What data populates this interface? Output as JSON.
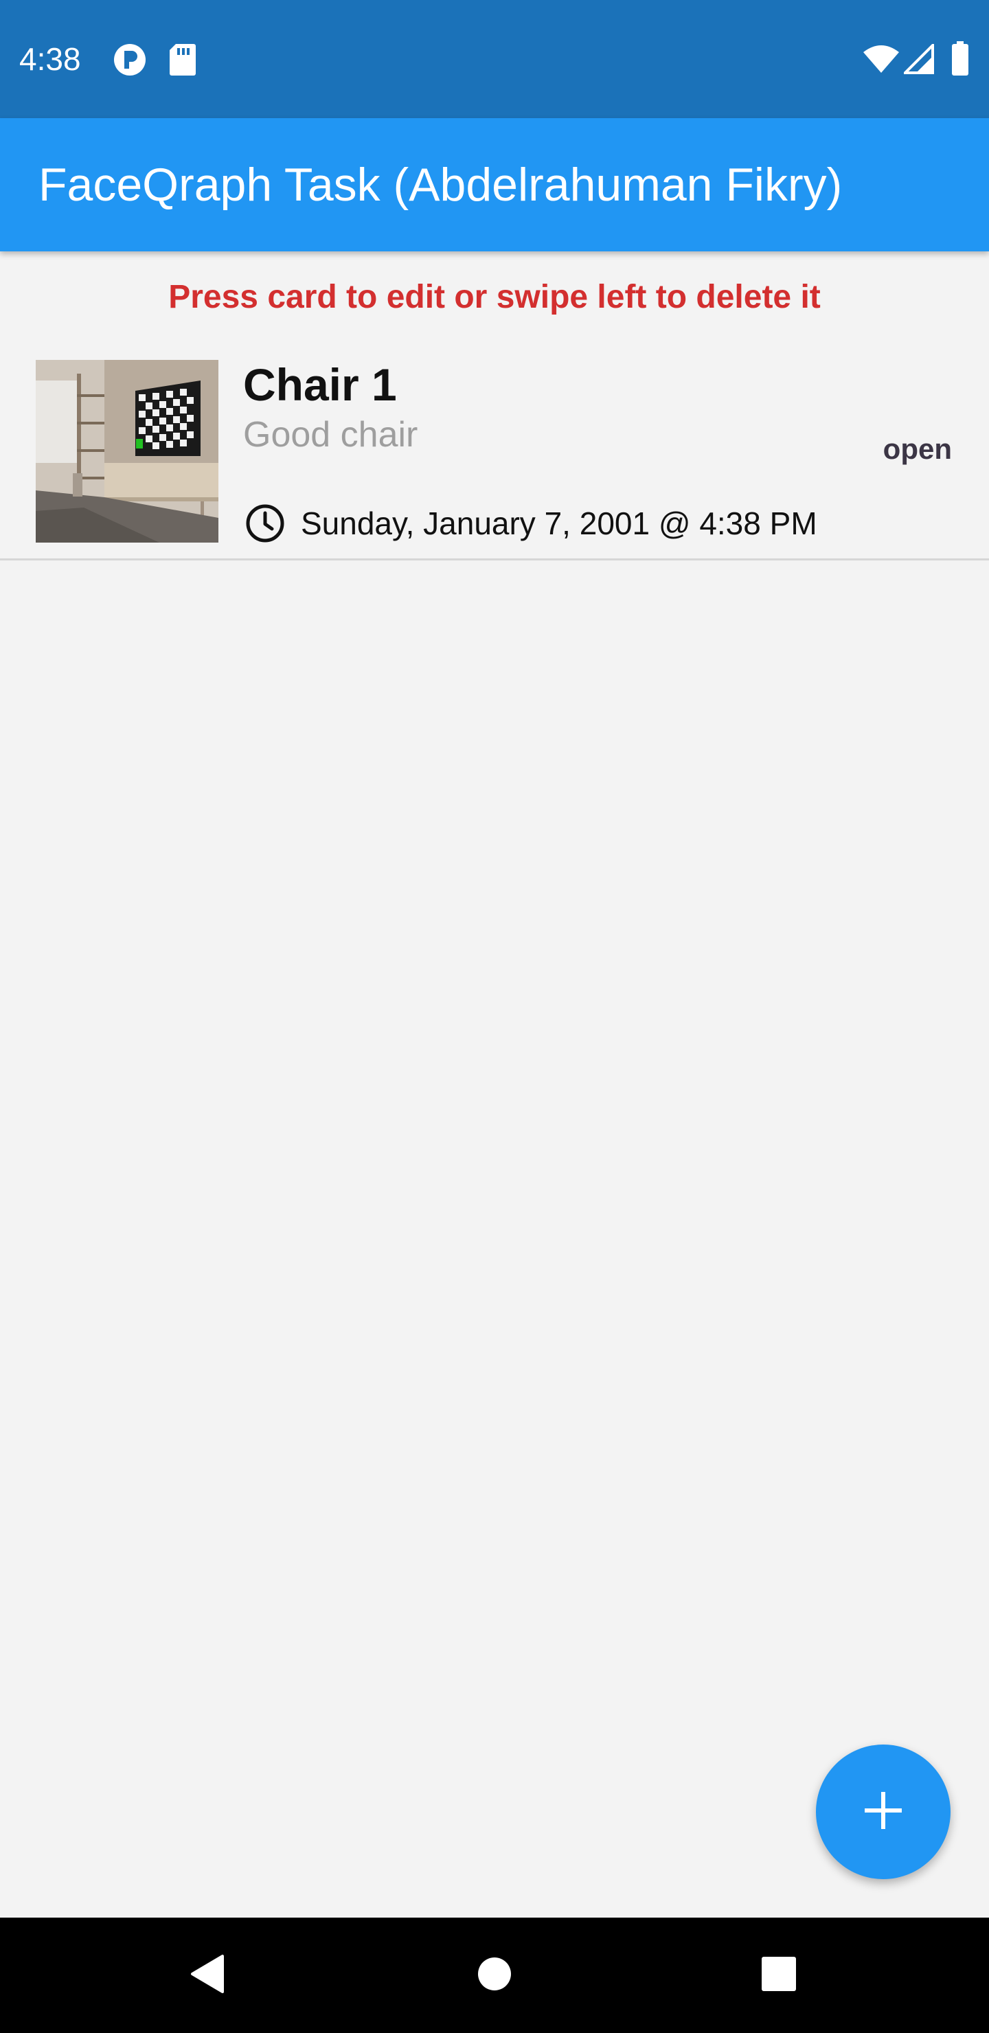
{
  "status_bar": {
    "time": "4:38",
    "background_color": "#1b72b9",
    "left_icons": [
      "p-notification-icon",
      "sd-card-icon"
    ],
    "right_icons": [
      "wifi-icon",
      "cellular-signal-icon",
      "battery-icon"
    ]
  },
  "app_bar": {
    "title": "FaceQraph Task (Abdelrahuman Fikry)",
    "background_color": "#2196f3"
  },
  "hint": {
    "text": "Press card to edit or swipe left to delete it",
    "color": "#d32f2f"
  },
  "items": [
    {
      "title": "Chair 1",
      "subtitle": "Good chair",
      "status": "open",
      "datetime": "Sunday, January 7, 2001 @ 4:38 PM",
      "thumbnail_icon": "room-with-tv-thumbnail",
      "time_icon": "clock-icon"
    }
  ],
  "fab": {
    "icon": "plus-icon",
    "color": "#2196f3"
  },
  "nav_bar": {
    "buttons": [
      "back-icon",
      "home-icon",
      "recents-icon"
    ]
  }
}
